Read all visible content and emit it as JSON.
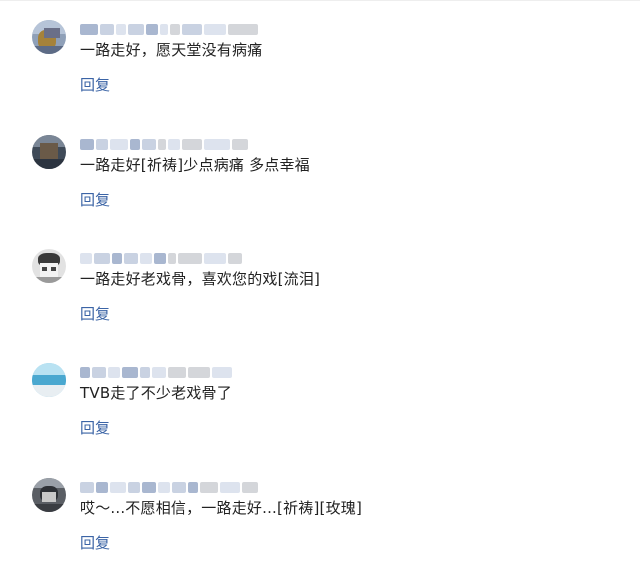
{
  "comments": [
    {
      "text": "一路走好，愿天堂没有病痛",
      "reply_label": "回复"
    },
    {
      "text": "一路走好[祈祷]少点病痛 多点幸福",
      "reply_label": "回复"
    },
    {
      "text": "一路走好老戏骨，喜欢您的戏[流泪]",
      "reply_label": "回复"
    },
    {
      "text": "TVB走了不少老戏骨了",
      "reply_label": "回复"
    },
    {
      "text": "哎～...不愿相信，一路走好...[祈祷][玫瑰]",
      "reply_label": "回复"
    }
  ],
  "colors": {
    "reply_link": "#3b64a6",
    "text": "#222222"
  }
}
